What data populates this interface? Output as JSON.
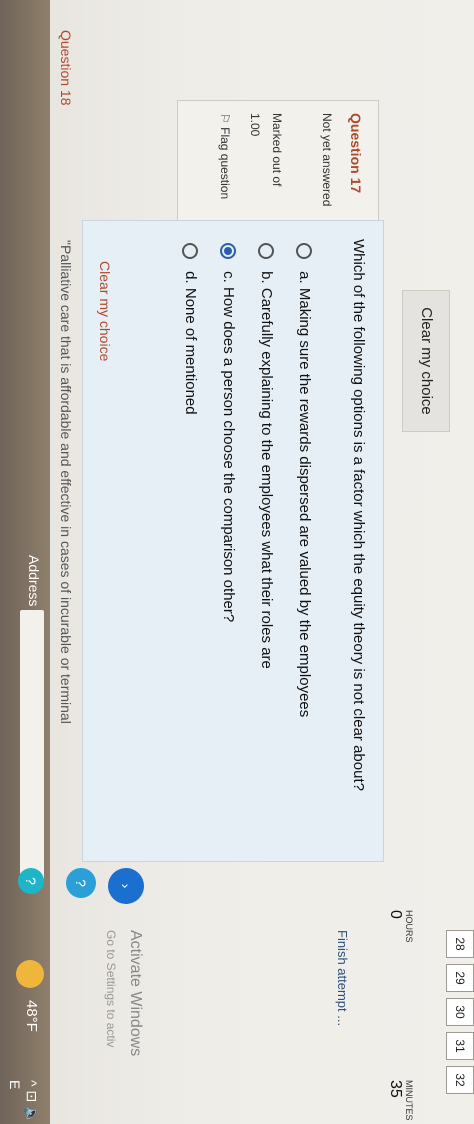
{
  "top_nav": {
    "clear_label": "Clear my choice"
  },
  "info": {
    "question_label": "Question",
    "question_number": "17",
    "status": "Not yet answered",
    "marked_out_of_label": "Marked out of",
    "marked_out_of_value": "1.00",
    "flag_label": "Flag question"
  },
  "question": {
    "text": "Which of the following options is a factor which the equity theory is not clear about?",
    "options": [
      {
        "letter": "a.",
        "text": "Making sure the rewards dispersed are valued by the employees",
        "selected": false
      },
      {
        "letter": "b.",
        "text": "Carefully explaining to the employees what their roles are",
        "selected": false
      },
      {
        "letter": "c.",
        "text": "How does a person choose the comparison other?",
        "selected": true
      },
      {
        "letter": "d.",
        "text": "None of mentioned",
        "selected": false
      }
    ],
    "clear_link": "Clear my choice"
  },
  "next_question": {
    "label": "Question 18",
    "preview": "\"Palliative care that is affordable and effective in cases of incurable or terminal"
  },
  "navigation": {
    "cells": [
      "28",
      "29",
      "30",
      "31",
      "32"
    ],
    "finish": "Finish attempt ..."
  },
  "timer": {
    "hours_label": "HOURS",
    "hours": "0",
    "minutes_label": "MINUTES",
    "minutes": "35"
  },
  "taskbar": {
    "address": "Address",
    "weather": "48°F",
    "sys": "^ ⊡ 🔈 E"
  },
  "watermark": {
    "line1": "Activate Windows",
    "line2": "Go to Settings to activ"
  },
  "accent": {
    "brand": "#1b6fcf",
    "warning": "#b04a2e",
    "panel": "#e6eff5"
  }
}
